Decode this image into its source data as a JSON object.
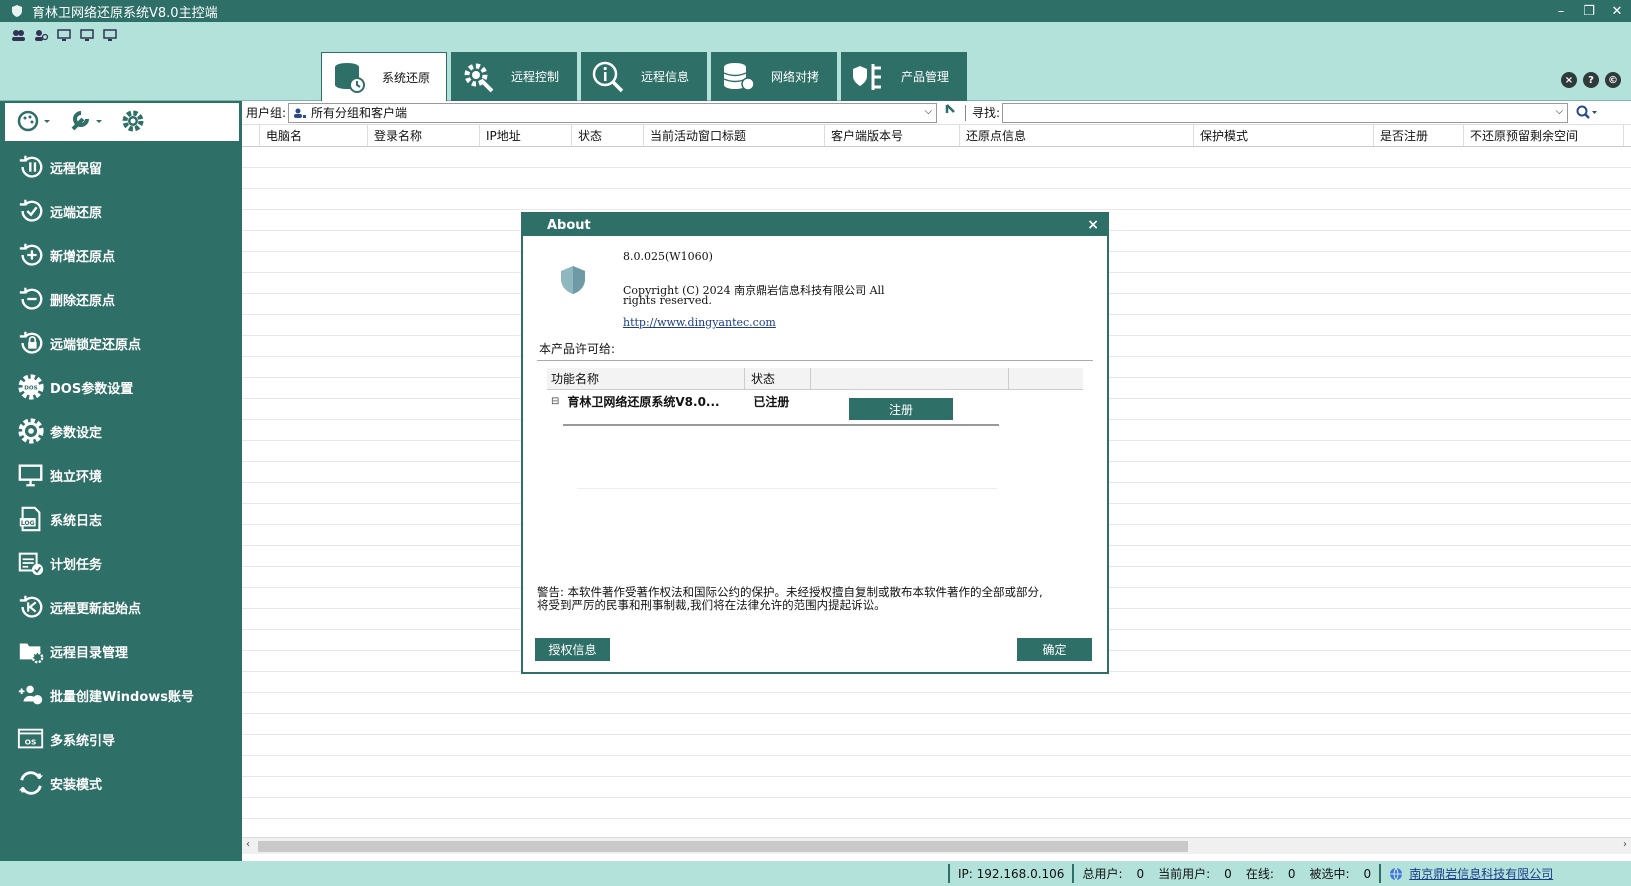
{
  "window": {
    "title": "育林卫网络还原系统V8.0主控端",
    "minimize": "–",
    "restore": "❐",
    "close": "✕"
  },
  "tabs": [
    {
      "label": "系统还原",
      "icon": "database-restore-icon",
      "active": true
    },
    {
      "label": "远程控制",
      "icon": "gear-wrench-icon",
      "active": false
    },
    {
      "label": "远程信息",
      "icon": "info-search-icon",
      "active": false
    },
    {
      "label": "网络对拷",
      "icon": "database-copy-icon",
      "active": false
    },
    {
      "label": "产品管理",
      "icon": "shield-tree-icon",
      "active": false
    }
  ],
  "top_right": {
    "close": "×",
    "help": "?",
    "copyright": "©"
  },
  "sidebar": {
    "items": [
      {
        "label": "远程保留",
        "icon": "pause-restore-icon"
      },
      {
        "label": "远端还原",
        "icon": "check-restore-icon"
      },
      {
        "label": "新增还原点",
        "icon": "add-restore-icon"
      },
      {
        "label": "删除还原点",
        "icon": "remove-restore-icon"
      },
      {
        "label": "远端锁定还原点",
        "icon": "lock-restore-icon"
      },
      {
        "label": "DOS参数设置",
        "icon": "dos-gear-icon",
        "badge": "DOS"
      },
      {
        "label": "参数设定",
        "icon": "gear-icon"
      },
      {
        "label": "独立环境",
        "icon": "monitor-icon"
      },
      {
        "label": "系统日志",
        "icon": "log-file-icon",
        "badge": "LOG"
      },
      {
        "label": "计划任务",
        "icon": "calendar-check-icon"
      },
      {
        "label": "远程更新起始点",
        "icon": "update-restore-icon"
      },
      {
        "label": "远程目录管理",
        "icon": "folder-gear-icon"
      },
      {
        "label": "批量创建Windows账号",
        "icon": "add-users-icon"
      },
      {
        "label": "多系统引导",
        "icon": "os-boot-icon",
        "badge": "OS"
      },
      {
        "label": "安装模式",
        "icon": "sync-arrows-icon"
      }
    ]
  },
  "filter": {
    "group_label": "用户组:",
    "group_value": "所有分组和客户端",
    "search_label": "寻找:",
    "search_value": ""
  },
  "grid": {
    "columns": [
      "电脑名",
      "登录名称",
      "IP地址",
      "状态",
      "当前活动窗口标题",
      "客户端版本号",
      "还原点信息",
      "保护模式",
      "是否注册",
      "不还原预留剩余空间"
    ]
  },
  "status": {
    "ip": "IP:  192.168.0.106",
    "total_label": "总用户:",
    "total": "0",
    "current_label": "当前用户:",
    "current": "0",
    "online_label": "在线:",
    "online": "0",
    "selected_label": "被选中:",
    "selected": "0",
    "company": "南京鼎岩信息科技有限公司"
  },
  "about": {
    "title": "About",
    "close": "×",
    "version": "8.0.025(W1060)",
    "copyright_line1": "Copyright (C) 2024 南京鼎岩信息科技有限公司 All",
    "copyright_line2": "rights reserved.",
    "url": "http://www.dingyantec.com",
    "license_to": "本产品许可给:",
    "col_feature": "功能名称",
    "col_status": "状态",
    "feature_expander": "⊟",
    "feature_name": "育林卫网络还原系统V8.0...",
    "feature_status": "已注册",
    "register_button": "注册",
    "warning_line1": "警告: 本软件著作受著作权法和国际公约的保护。未经授权擅自复制或散布本软件著作的全部或部分,",
    "warning_line2": "将受到严厉的民事和刑事制裁,我们将在法律允许的范围内提起诉讼。",
    "auth_button": "授权信息",
    "ok_button": "确定"
  },
  "colors": {
    "primary": "#2e6f67",
    "light": "#b3e2da"
  }
}
